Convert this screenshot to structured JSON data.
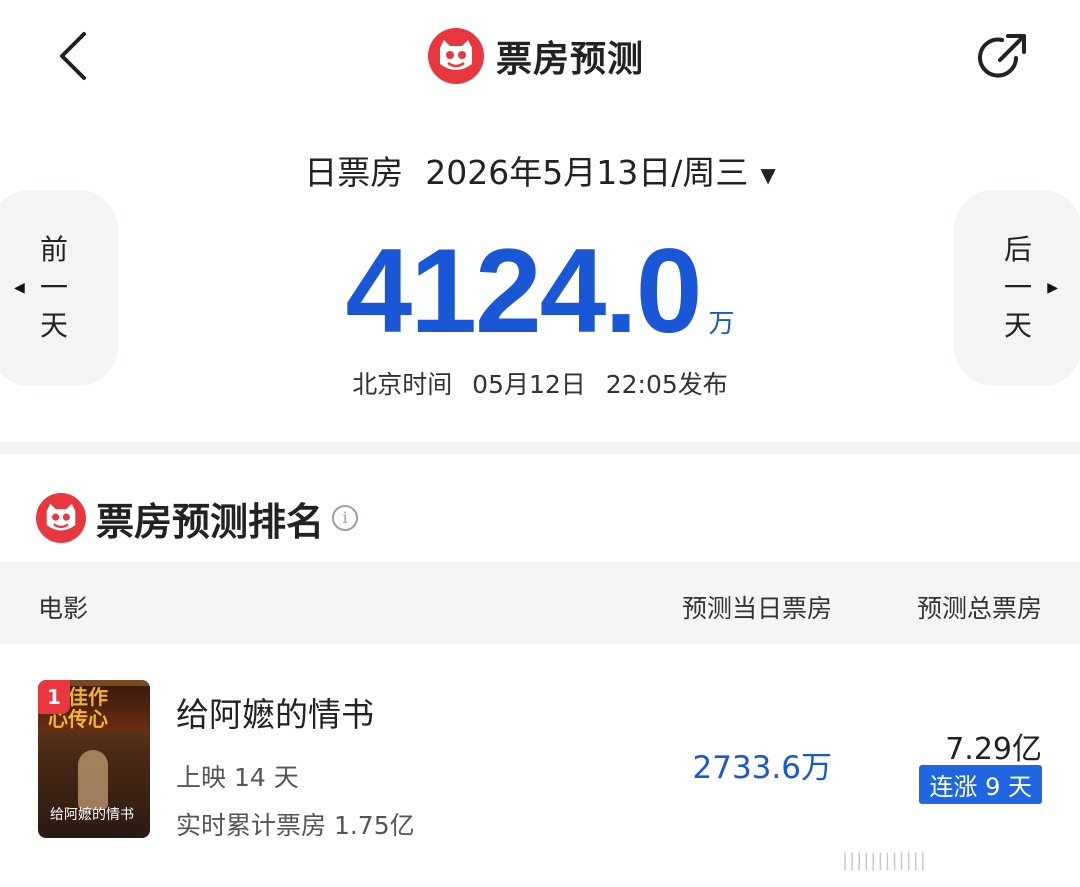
{
  "header": {
    "title": "票房预测",
    "back_icon": "chevron-left-icon",
    "share_icon": "share-icon",
    "brand_color": "#e8373e"
  },
  "date_bar": {
    "type_label": "日票房",
    "date": "2026年5月13日/周三",
    "caret": "▼"
  },
  "forecast": {
    "value": "4124.0",
    "unit": "万",
    "release_prefix": "北京时间",
    "release_date": "05月12日",
    "release_time": "22:05发布",
    "accent_color": "#1a57d6"
  },
  "nav": {
    "prev_label": "前一天",
    "next_label": "后一天"
  },
  "ranking": {
    "title": "票房预测排名",
    "columns": {
      "movie": "电影",
      "predicted_day": "预测当日票房",
      "predicted_total": "预测总票房"
    },
    "rows": [
      {
        "rank": "1",
        "name": "给阿嬷的情书",
        "days": "上映 14 天",
        "cumulative": "实时累计票房 1.75亿",
        "predicted_day": "2733.6万",
        "predicted_total": "7.29亿",
        "streak": "连涨 9 天",
        "poster_text": "神佳作\n心传心",
        "poster_title": "给阿嬷的情书"
      }
    ]
  },
  "watermark": "||||||||||||"
}
